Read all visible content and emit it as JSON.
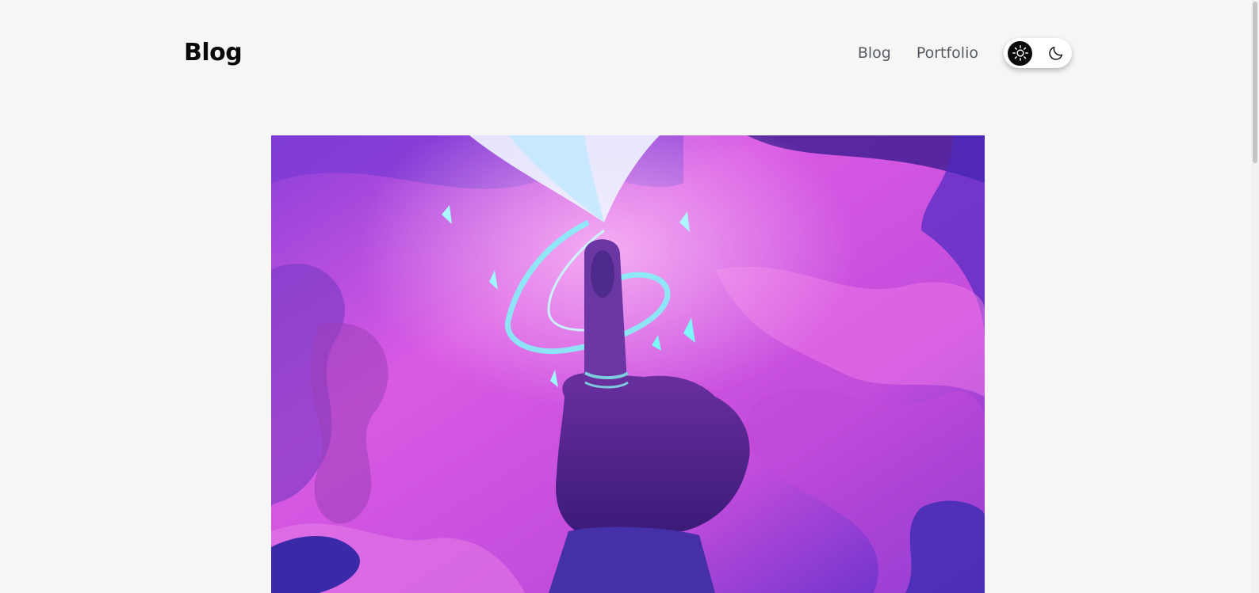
{
  "header": {
    "brand": "Blog",
    "nav": [
      {
        "label": "Blog"
      },
      {
        "label": "Portfolio"
      }
    ],
    "theme_toggle": {
      "light_icon": "sun-icon",
      "dark_icon": "moon-icon",
      "active": "light"
    }
  },
  "hero": {
    "illustration": "hand-with-glowing-butterfly-illustration"
  },
  "colors": {
    "background": "#f6f6f6",
    "brand_text": "#0b0b0b",
    "nav_text": "#555a61",
    "toggle_active_bg": "#0a0a0a",
    "illustration_magenta": "#d24fe0",
    "illustration_violet": "#6a35d6",
    "illustration_cyan": "#6ff3f4"
  }
}
